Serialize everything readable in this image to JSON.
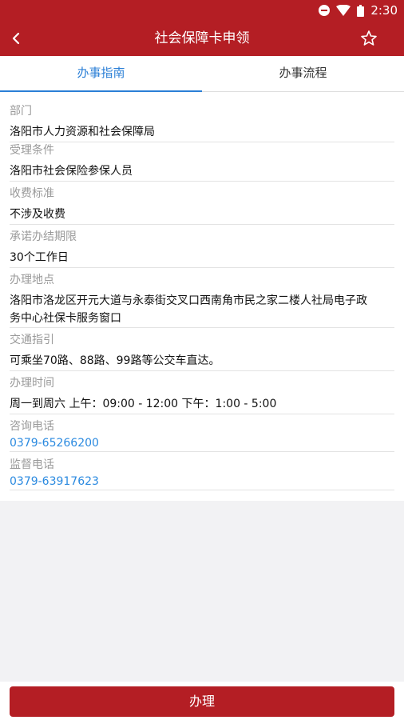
{
  "status_bar": {
    "time": "2:30"
  },
  "header": {
    "title": "社会保障卡申领"
  },
  "tabs": [
    {
      "label": "办事指南",
      "active": true
    },
    {
      "label": "办事流程",
      "active": false
    }
  ],
  "fields": [
    {
      "label": "部门",
      "value": "洛阳市人力资源和社会保障局"
    },
    {
      "label": "受理条件",
      "value": "洛阳市社会保险参保人员"
    },
    {
      "label": "收费标准",
      "value": "不涉及收费"
    },
    {
      "label": "承诺办结期限",
      "value": "30个工作日"
    },
    {
      "label": "办理地点",
      "value_line1": "洛阳市洛龙区开元大道与永泰街交叉口西南角市民之家二楼人社局电子政",
      "value_line2": "务中心社保卡服务窗口"
    },
    {
      "label": "交通指引",
      "value": "可乘坐70路、88路、99路等公交车直达。"
    },
    {
      "label": "办理时间",
      "value": "周一到周六 上午：09:00 - 12:00 下午：1:00 - 5:00"
    },
    {
      "label": "咨询电话",
      "value": "0379-65266200"
    },
    {
      "label": "监督电话",
      "value": "0379-63917623"
    }
  ],
  "actions": {
    "submit_label": "办理"
  },
  "colors": {
    "primary": "#b41e24",
    "accent": "#2b7fd6",
    "link": "#2b8ae0"
  }
}
